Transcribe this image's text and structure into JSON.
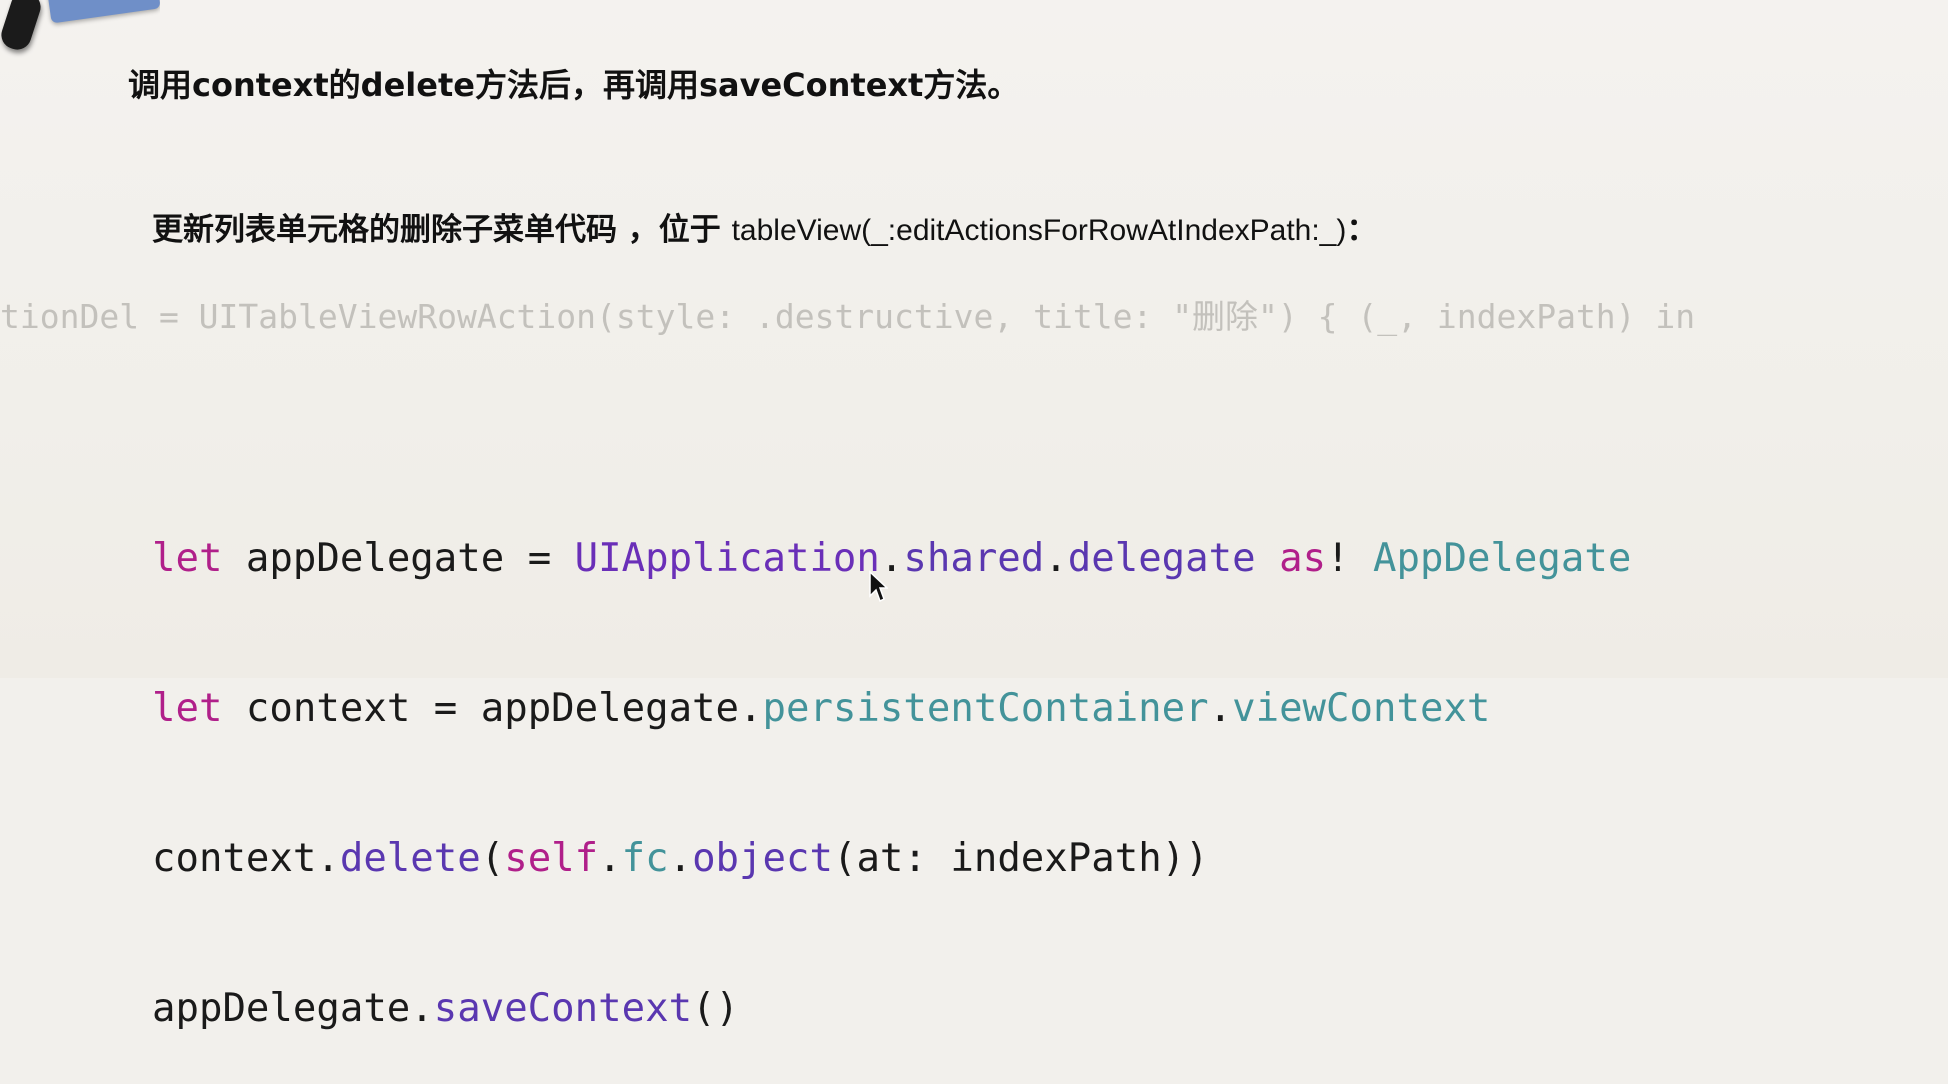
{
  "slide": {
    "instruction_1": "调用context的delete方法后，再调用saveContext方法。",
    "instruction_2_prefix": "更新列表单元格的删除子菜单代码 ，位于 ",
    "instruction_2_signature": "tableView(_:editActionsForRowAtIndexPath:_)",
    "instruction_2_suffix": "："
  },
  "faded_code": {
    "line": "tionDel = UITableViewRowAction(style: .destructive, title: \"删除\") { (_, indexPath) in"
  },
  "code": {
    "l1": {
      "t1": "let",
      "t2": " appDelegate = ",
      "t3": "UIApplication",
      "t4": ".",
      "t5": "shared",
      "t6": ".",
      "t7": "delegate",
      "t8": " ",
      "t9": "as",
      "t10": "! ",
      "t11": "AppDelegate"
    },
    "l2": {
      "t1": "let",
      "t2": " context = appDelegate.",
      "t3": "persistentContainer",
      "t4": ".",
      "t5": "viewContext"
    },
    "l3": {
      "t1": "context.",
      "t2": "delete",
      "t3": "(",
      "t4": "self",
      "t5": ".",
      "t6": "fc",
      "t7": ".",
      "t8": "object",
      "t9": "(at: indexPath))"
    },
    "l4": {
      "t1": "appDelegate.",
      "t2": "saveContext",
      "t3": "()"
    }
  },
  "colors": {
    "keyword": "#b01f8a",
    "type": "#6a2fb8",
    "property": "#43939a",
    "method": "#5a37b0",
    "faded": "#c3c1bc"
  }
}
